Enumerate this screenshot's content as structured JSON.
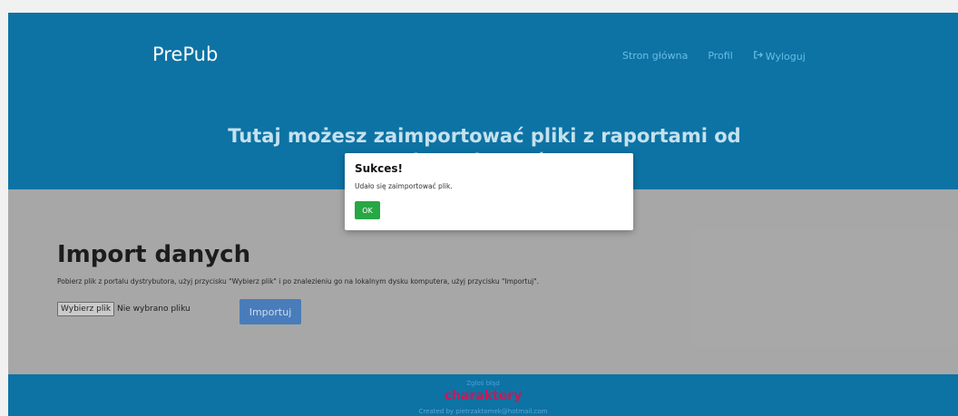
{
  "navbar": {
    "brand": "PrePub",
    "links": [
      {
        "label": "Stron główna"
      },
      {
        "label": "Profil"
      },
      {
        "label": "Wyloguj",
        "icon": "sign-out-icon"
      }
    ]
  },
  "hero": {
    "title": "Tutaj możesz zaimportować pliki z raportami od dystrybutorów"
  },
  "import": {
    "heading": "Import danych",
    "description": "Pobierz plik z portalu dystrybutora, użyj przycisku \"Wybierz plik\" i po znalezieniu go na lokalnym dysku komputera, użyj przycisku \"Importuj\".",
    "file_button": "Wybierz plik",
    "file_status": "Nie wybrano pliku",
    "import_button": "Importuj"
  },
  "footer": {
    "report_link": "Zgłoś błąd",
    "logo_text": "charaktery",
    "credits": "Created by pietrzaktomek@hotmail.com"
  },
  "modal": {
    "title": "Sukces!",
    "message": "Udało się zaimportować plik.",
    "ok_button": "OK"
  },
  "colors": {
    "primary": "#0e76a8",
    "content_bg": "#ababab",
    "import_button": "#4b7fbe",
    "ok_button": "#28a745",
    "logo": "#cc1a5a"
  }
}
